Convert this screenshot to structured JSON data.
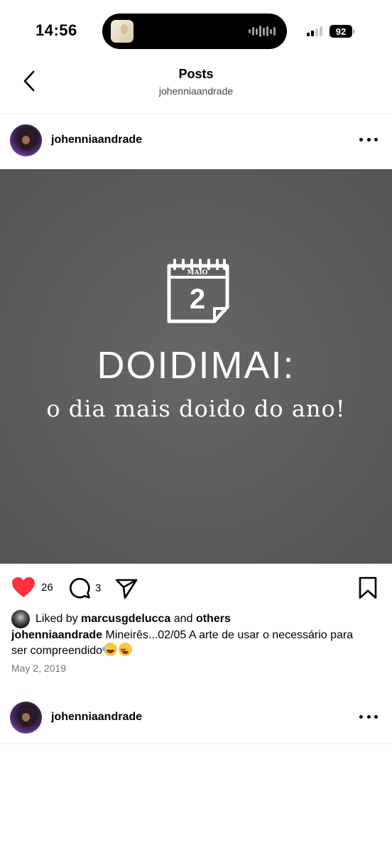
{
  "status_bar": {
    "time": "14:56",
    "battery": "92",
    "signal_bars_active": 2
  },
  "header": {
    "title": "Posts",
    "subtitle": "johenniaandrade",
    "back_icon": "chevron-left-icon"
  },
  "posts": [
    {
      "username": "johenniaandrade",
      "image": {
        "calendar_month": "MAIO",
        "calendar_day": "2",
        "headline": "DOIDIMAI:",
        "subline": "o dia mais doido do ano!"
      },
      "actions": {
        "likes": "26",
        "comments": "3",
        "liked": true,
        "like_color": "#ff3040"
      },
      "liked_by": {
        "prefix": "Liked by",
        "user": "marcusgdelucca",
        "conjunction": "and",
        "others": "others"
      },
      "caption": {
        "user": "johenniaandrade",
        "text": "Mineirês...02/05 A arte de usar o necessário para ser compreendido",
        "emojis": [
          "face-with-tears-of-joy",
          "smiling-face-with-heart-eyes"
        ]
      },
      "date": "May 2, 2019"
    },
    {
      "username": "johenniaandrade"
    }
  ]
}
